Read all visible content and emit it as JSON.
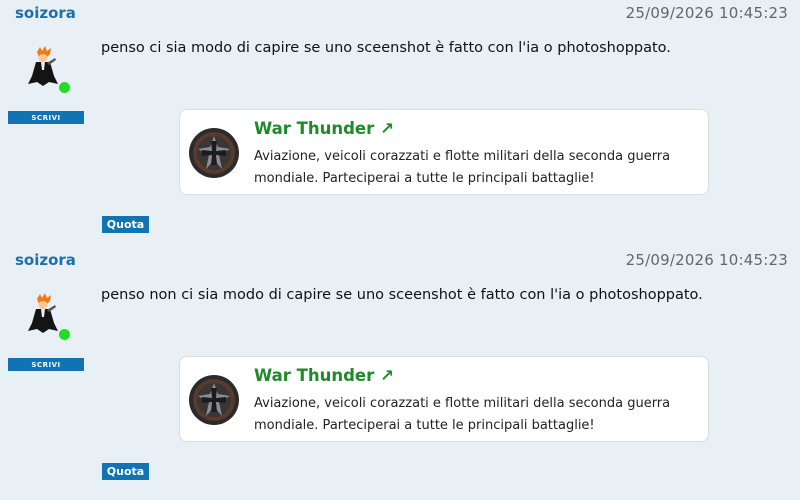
{
  "posts": [
    {
      "username": "soizora",
      "timestamp": "25/09/2026 10:45:23",
      "message": "penso ci sia modo di capire se uno sceenshot è fatto con l'ia o photoshoppato.",
      "write_label": "SCRIVI",
      "quote_label": "Quota",
      "online": true,
      "link_card": {
        "title": "War Thunder ↗",
        "description": "Aviazione, veicoli corazzati e flotte militari della seconda guerra mondiale. Parteciperai a tutte le principali battaglie!",
        "icon": "war-thunder-logo"
      }
    },
    {
      "username": "soizora",
      "timestamp": "25/09/2026 10:45:23",
      "message": "penso non ci sia modo di capire se uno sceenshot è fatto con l'ia o photoshoppato.",
      "write_label": "SCRIVI",
      "quote_label": "Quota",
      "online": true,
      "link_card": {
        "title": "War Thunder ↗",
        "description": "Aviazione, veicoli corazzati e flotte militari della seconda guerra mondiale. Parteciperai a tutte le principali battaglie!",
        "icon": "war-thunder-logo"
      }
    }
  ],
  "colors": {
    "background": "#e8f0f6",
    "username": "#1f6fa8",
    "button": "#0f73b4",
    "card_title": "#1f8a2a",
    "online": "#22dd22"
  }
}
